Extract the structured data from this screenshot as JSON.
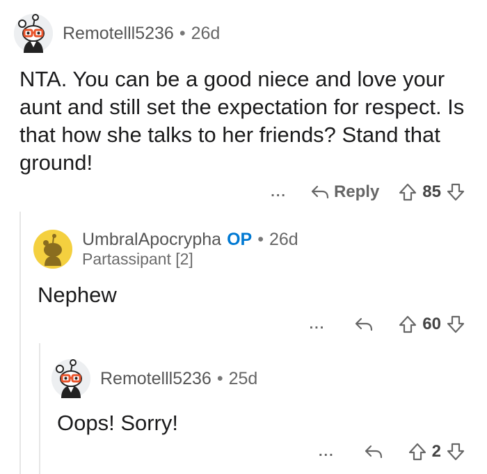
{
  "comments": [
    {
      "author": "Remotelll5236",
      "age": "26d",
      "body": "NTA.  You can be a good niece and love your aunt and still set the expectation for respect.  Is that how she talks to her friends?  Stand that ground!",
      "more": "...",
      "reply_label": "Reply",
      "score": "85",
      "avatar_icon": "snoo-glasses-avatar"
    },
    {
      "author": "UmbralApocrypha",
      "op_badge": "OP",
      "age": "26d",
      "flair": "Partassipant [2]",
      "body": "Nephew",
      "more": "...",
      "score": "60",
      "avatar_icon": "snoo-yellow-avatar"
    },
    {
      "author": "Remotelll5236",
      "age": "25d",
      "body": "Oops! Sorry!",
      "more": "...",
      "score": "2",
      "avatar_icon": "snoo-glasses-avatar"
    }
  ],
  "separator": "•",
  "colors": {
    "op": "#0079d3",
    "yellow_avatar": "#f4d03f",
    "meta": "#666666"
  }
}
